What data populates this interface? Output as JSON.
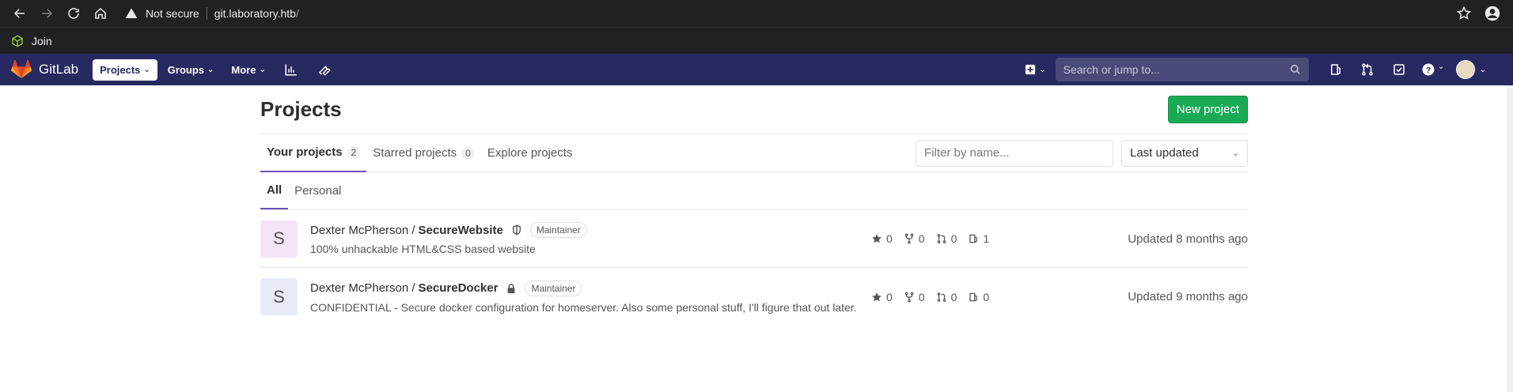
{
  "browser": {
    "not_secure": "Not secure",
    "host": "git.laboratory.htb",
    "path": "/",
    "bookmark_label": "Join"
  },
  "gitlab_nav": {
    "brand": "GitLab",
    "menu": [
      "Projects",
      "Groups",
      "More"
    ],
    "search_placeholder": "Search or jump to..."
  },
  "page": {
    "title": "Projects",
    "new_project_label": "New project",
    "tabs": [
      {
        "label": "Your projects",
        "count": "2"
      },
      {
        "label": "Starred projects",
        "count": "0"
      },
      {
        "label": "Explore projects"
      }
    ],
    "filter_placeholder": "Filter by name...",
    "sort_value": "Last updated",
    "subtabs": [
      "All",
      "Personal"
    ]
  },
  "projects": [
    {
      "avatar_letter": "S",
      "avatar_color": "#f3e5f5",
      "namespace": "Dexter McPherson /",
      "name": "SecureWebsite",
      "visibility_icon": "shield-icon",
      "role": "Maintainer",
      "description": "100% unhackable HTML&CSS based website",
      "stars": "0",
      "forks": "0",
      "merge_requests": "0",
      "issues": "1",
      "updated": "Updated 8 months ago"
    },
    {
      "avatar_letter": "S",
      "avatar_color": "#e8eaf6",
      "namespace": "Dexter McPherson /",
      "name": "SecureDocker",
      "visibility_icon": "lock-icon",
      "role": "Maintainer",
      "description": "CONFIDENTIAL - Secure docker configuration for homeserver. Also some personal stuff, I'll figure that out later.",
      "stars": "0",
      "forks": "0",
      "merge_requests": "0",
      "issues": "0",
      "updated": "Updated 9 months ago"
    }
  ],
  "colors": {
    "gitlab_nav_bg": "#292961",
    "accent_green": "#1aaa55",
    "tab_underline": "#6b4fbb"
  }
}
